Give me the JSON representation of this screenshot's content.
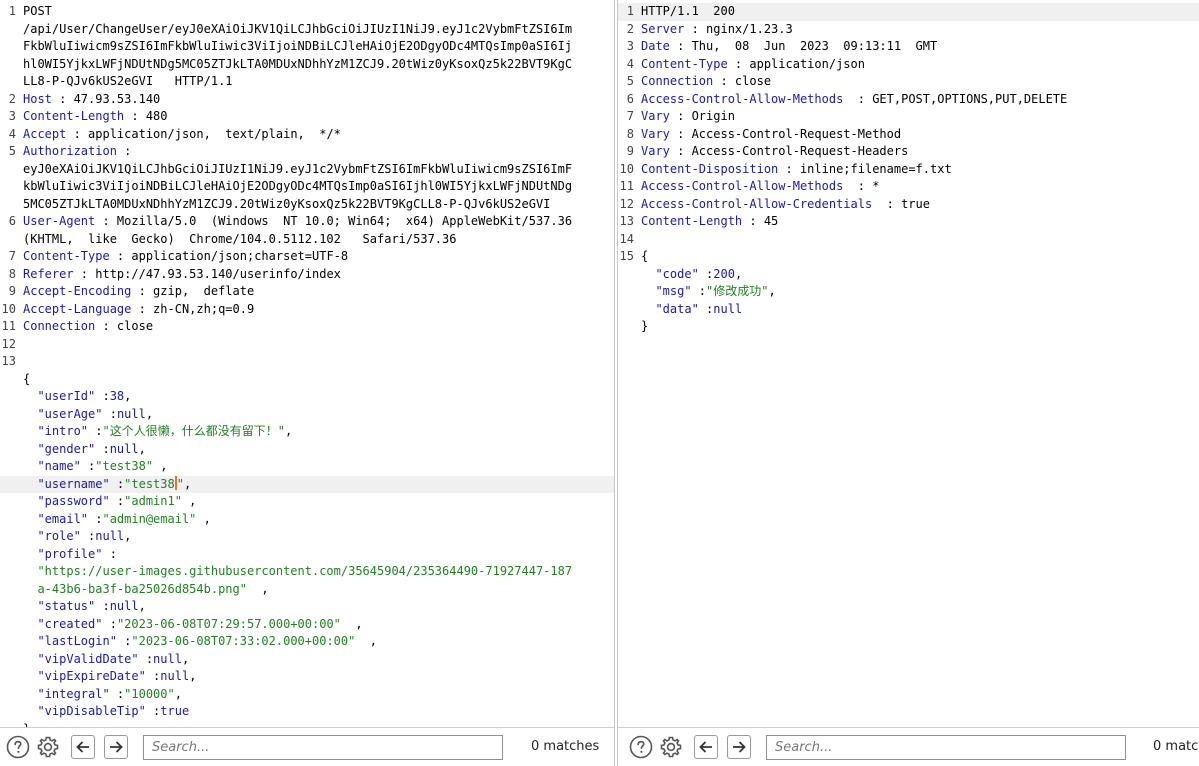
{
  "request": {
    "lines": [
      {
        "n": "1",
        "parts": [
          {
            "t": "POST",
            "c": ""
          }
        ]
      },
      {
        "n": "",
        "parts": [
          {
            "t": "/api/User/ChangeUser/eyJ0eXAiOiJKV1QiLCJhbGciOiJIUzI1NiJ9.eyJ1c2VybmFtZSI6Im",
            "c": ""
          }
        ]
      },
      {
        "n": "",
        "parts": [
          {
            "t": "FkbWluIiwicm9sZSI6ImFkbWluIiwic3ViIjoiNDBiLCJleHAiOjE2ODgyODc4MTQsImp0aSI6Ij",
            "c": ""
          }
        ]
      },
      {
        "n": "",
        "parts": [
          {
            "t": "hl0WI5YjkxLWFjNDUtNDg5MC05ZTJkLTA0MDUxNDhhYzM1ZCJ9.20tWiz0yKsoxQz5k22BVT9KgC",
            "c": ""
          }
        ]
      },
      {
        "n": "",
        "parts": [
          {
            "t": "LL8-P-QJv6kUS2eGVI   HTTP/1.1",
            "c": ""
          }
        ]
      },
      {
        "n": "2",
        "parts": [
          {
            "t": "Host",
            "c": "k"
          },
          {
            "t": " : 47.93.53.140",
            "c": ""
          }
        ]
      },
      {
        "n": "3",
        "parts": [
          {
            "t": "Content-Length",
            "c": "k"
          },
          {
            "t": " : 480",
            "c": ""
          }
        ]
      },
      {
        "n": "4",
        "parts": [
          {
            "t": "Accept",
            "c": "k"
          },
          {
            "t": " : application/json,  text/plain,  */*",
            "c": ""
          }
        ]
      },
      {
        "n": "5",
        "parts": [
          {
            "t": "Authorization",
            "c": "k"
          },
          {
            "t": " :",
            "c": ""
          }
        ]
      },
      {
        "n": "",
        "parts": [
          {
            "t": "eyJ0eXAiOiJKV1QiLCJhbGciOiJIUzI1NiJ9.eyJ1c2VybmFtZSI6ImFkbWluIiwicm9sZSI6ImF",
            "c": ""
          }
        ]
      },
      {
        "n": "",
        "parts": [
          {
            "t": "kbWluIiwic3ViIjoiNDBiLCJleHAiOjE2ODgyODc4MTQsImp0aSI6Ijhl0WI5YjkxLWFjNDUtNDg",
            "c": ""
          }
        ]
      },
      {
        "n": "",
        "parts": [
          {
            "t": "5MC05ZTJkLTA0MDUxNDhhYzM1ZCJ9.20tWiz0yKsoxQz5k22BVT9KgCLL8-P-QJv6kUS2eGVI",
            "c": ""
          }
        ]
      },
      {
        "n": "6",
        "parts": [
          {
            "t": "User-Agent",
            "c": "k"
          },
          {
            "t": " : Mozilla/5.0  (Windows  NT 10.0; Win64;  x64) AppleWebKit/537.36",
            "c": ""
          }
        ]
      },
      {
        "n": "",
        "parts": [
          {
            "t": "(KHTML,  like  Gecko)  Chrome/104.0.5112.102   Safari/537.36",
            "c": ""
          }
        ]
      },
      {
        "n": "7",
        "parts": [
          {
            "t": "Content-Type",
            "c": "k"
          },
          {
            "t": " : application/json;charset=UTF-8",
            "c": ""
          }
        ]
      },
      {
        "n": "8",
        "parts": [
          {
            "t": "Referer",
            "c": "k"
          },
          {
            "t": " : http://47.93.53.140/userinfo/index",
            "c": ""
          }
        ]
      },
      {
        "n": "9",
        "parts": [
          {
            "t": "Accept-Encoding",
            "c": "k"
          },
          {
            "t": " : gzip,  deflate",
            "c": ""
          }
        ]
      },
      {
        "n": "10",
        "parts": [
          {
            "t": "Accept-Language",
            "c": "k"
          },
          {
            "t": " : zh-CN,zh;q=0.9",
            "c": ""
          }
        ]
      },
      {
        "n": "11",
        "parts": [
          {
            "t": "Connection",
            "c": "k"
          },
          {
            "t": " : close",
            "c": ""
          }
        ]
      },
      {
        "n": "12",
        "parts": []
      },
      {
        "n": "13",
        "parts": []
      },
      {
        "n": "",
        "parts": [
          {
            "t": "{",
            "c": ""
          }
        ]
      },
      {
        "n": "",
        "parts": [
          {
            "t": "  \"userId\"",
            "c": "k"
          },
          {
            "t": " :",
            "c": ""
          },
          {
            "t": "38",
            "c": "n"
          },
          {
            "t": ",",
            "c": ""
          }
        ]
      },
      {
        "n": "",
        "parts": [
          {
            "t": "  \"userAge\"",
            "c": "k"
          },
          {
            "t": " :",
            "c": ""
          },
          {
            "t": "null",
            "c": "n"
          },
          {
            "t": ",",
            "c": ""
          }
        ]
      },
      {
        "n": "",
        "parts": [
          {
            "t": "  \"intro\"",
            "c": "k"
          },
          {
            "t": " :",
            "c": ""
          },
          {
            "t": "\"这个人很懒，什么都没有留下！\"",
            "c": "s"
          },
          {
            "t": ",",
            "c": ""
          }
        ]
      },
      {
        "n": "",
        "parts": [
          {
            "t": "  \"gender\"",
            "c": "k"
          },
          {
            "t": " :",
            "c": ""
          },
          {
            "t": "null",
            "c": "n"
          },
          {
            "t": ",",
            "c": ""
          }
        ]
      },
      {
        "n": "",
        "parts": [
          {
            "t": "  \"name\"",
            "c": "k"
          },
          {
            "t": " :",
            "c": ""
          },
          {
            "t": "\"test38\"",
            "c": "s"
          },
          {
            "t": " ,",
            "c": ""
          }
        ]
      },
      {
        "n": "",
        "hl": true,
        "caret": true,
        "parts": [
          {
            "t": "  \"username\"",
            "c": "k"
          },
          {
            "t": " :",
            "c": ""
          },
          {
            "t": "\"test38",
            "c": "s"
          },
          {
            "t": "\"",
            "c": "s",
            "caret": true
          },
          {
            "t": ",",
            "c": ""
          }
        ]
      },
      {
        "n": "",
        "parts": [
          {
            "t": "  \"password\"",
            "c": "k"
          },
          {
            "t": " :",
            "c": ""
          },
          {
            "t": "\"admin1\"",
            "c": "s"
          },
          {
            "t": " ,",
            "c": ""
          }
        ]
      },
      {
        "n": "",
        "parts": [
          {
            "t": "  \"email\"",
            "c": "k"
          },
          {
            "t": " :",
            "c": ""
          },
          {
            "t": "\"admin@email\"",
            "c": "s"
          },
          {
            "t": " ,",
            "c": ""
          }
        ]
      },
      {
        "n": "",
        "parts": [
          {
            "t": "  \"role\"",
            "c": "k"
          },
          {
            "t": " :",
            "c": ""
          },
          {
            "t": "null",
            "c": "n"
          },
          {
            "t": ",",
            "c": ""
          }
        ]
      },
      {
        "n": "",
        "parts": [
          {
            "t": "  \"profile\"",
            "c": "k"
          },
          {
            "t": " :",
            "c": ""
          }
        ]
      },
      {
        "n": "",
        "parts": [
          {
            "t": "  \"https://user-images.githubusercontent.com/35645904/235364490-71927447-187",
            "c": "s"
          }
        ]
      },
      {
        "n": "",
        "parts": [
          {
            "t": "  a-43b6-ba3f-ba25026d854b.png\"",
            "c": "s"
          },
          {
            "t": "  ,",
            "c": ""
          }
        ]
      },
      {
        "n": "",
        "parts": [
          {
            "t": "  \"status\"",
            "c": "k"
          },
          {
            "t": " :",
            "c": ""
          },
          {
            "t": "null",
            "c": "n"
          },
          {
            "t": ",",
            "c": ""
          }
        ]
      },
      {
        "n": "",
        "parts": [
          {
            "t": "  \"created\"",
            "c": "k"
          },
          {
            "t": " :",
            "c": ""
          },
          {
            "t": "\"2023-06-08T07:29:57.000+00:00\"",
            "c": "s"
          },
          {
            "t": "  ,",
            "c": ""
          }
        ]
      },
      {
        "n": "",
        "parts": [
          {
            "t": "  \"lastLogin\"",
            "c": "k"
          },
          {
            "t": " :",
            "c": ""
          },
          {
            "t": "\"2023-06-08T07:33:02.000+00:00\"",
            "c": "s"
          },
          {
            "t": "  ,",
            "c": ""
          }
        ]
      },
      {
        "n": "",
        "parts": [
          {
            "t": "  \"vipValidDate\"",
            "c": "k"
          },
          {
            "t": " :",
            "c": ""
          },
          {
            "t": "null",
            "c": "n"
          },
          {
            "t": ",",
            "c": ""
          }
        ]
      },
      {
        "n": "",
        "parts": [
          {
            "t": "  \"vipExpireDate\"",
            "c": "k"
          },
          {
            "t": " :",
            "c": ""
          },
          {
            "t": "null",
            "c": "n"
          },
          {
            "t": ",",
            "c": ""
          }
        ]
      },
      {
        "n": "",
        "parts": [
          {
            "t": "  \"integral\"",
            "c": "k"
          },
          {
            "t": " :",
            "c": ""
          },
          {
            "t": "\"10000\"",
            "c": "s"
          },
          {
            "t": ",",
            "c": ""
          }
        ]
      },
      {
        "n": "",
        "parts": [
          {
            "t": "  \"vipDisableTip\"",
            "c": "k"
          },
          {
            "t": " :",
            "c": ""
          },
          {
            "t": "true",
            "c": "n"
          }
        ]
      },
      {
        "n": "",
        "parts": [
          {
            "t": "}",
            "c": ""
          }
        ]
      }
    ],
    "search_placeholder": "Search...",
    "matches": "0 matches"
  },
  "response": {
    "lines": [
      {
        "n": "1",
        "hl": true,
        "parts": [
          {
            "t": "HTTP/1.1  200",
            "c": ""
          }
        ]
      },
      {
        "n": "2",
        "parts": [
          {
            "t": "Server",
            "c": "k"
          },
          {
            "t": " : nginx/1.23.3",
            "c": ""
          }
        ]
      },
      {
        "n": "3",
        "parts": [
          {
            "t": "Date",
            "c": "k"
          },
          {
            "t": " : Thu,  08  Jun  2023  09:13:11  GMT",
            "c": ""
          }
        ]
      },
      {
        "n": "4",
        "parts": [
          {
            "t": "Content-Type",
            "c": "k"
          },
          {
            "t": " : application/json",
            "c": ""
          }
        ]
      },
      {
        "n": "5",
        "parts": [
          {
            "t": "Connection",
            "c": "k"
          },
          {
            "t": " : close",
            "c": ""
          }
        ]
      },
      {
        "n": "6",
        "parts": [
          {
            "t": "Access-Control-Allow-Methods",
            "c": "k"
          },
          {
            "t": "  : GET,POST,OPTIONS,PUT,DELETE",
            "c": ""
          }
        ]
      },
      {
        "n": "7",
        "parts": [
          {
            "t": "Vary",
            "c": "k"
          },
          {
            "t": " : Origin",
            "c": ""
          }
        ]
      },
      {
        "n": "8",
        "parts": [
          {
            "t": "Vary",
            "c": "k"
          },
          {
            "t": " : Access-Control-Request-Method",
            "c": ""
          }
        ]
      },
      {
        "n": "9",
        "parts": [
          {
            "t": "Vary",
            "c": "k"
          },
          {
            "t": " : Access-Control-Request-Headers",
            "c": ""
          }
        ]
      },
      {
        "n": "10",
        "parts": [
          {
            "t": "Content-Disposition",
            "c": "k"
          },
          {
            "t": " : inline;filename=f.txt",
            "c": ""
          }
        ]
      },
      {
        "n": "11",
        "parts": [
          {
            "t": "Access-Control-Allow-Methods",
            "c": "k"
          },
          {
            "t": "  : *",
            "c": ""
          }
        ]
      },
      {
        "n": "12",
        "parts": [
          {
            "t": "Access-Control-Allow-Credentials",
            "c": "k"
          },
          {
            "t": "  : true",
            "c": ""
          }
        ]
      },
      {
        "n": "13",
        "parts": [
          {
            "t": "Content-Length",
            "c": "k"
          },
          {
            "t": " : 45",
            "c": ""
          }
        ]
      },
      {
        "n": "14",
        "parts": []
      },
      {
        "n": "15",
        "parts": [
          {
            "t": "{",
            "c": ""
          }
        ]
      },
      {
        "n": "",
        "parts": [
          {
            "t": "  \"code\"",
            "c": "k"
          },
          {
            "t": " :",
            "c": ""
          },
          {
            "t": "200",
            "c": "n"
          },
          {
            "t": ",",
            "c": ""
          }
        ]
      },
      {
        "n": "",
        "parts": [
          {
            "t": "  \"msg\"",
            "c": "k"
          },
          {
            "t": " :",
            "c": ""
          },
          {
            "t": "\"修改成功\"",
            "c": "s"
          },
          {
            "t": ",",
            "c": ""
          }
        ]
      },
      {
        "n": "",
        "parts": [
          {
            "t": "  \"data\"",
            "c": "k"
          },
          {
            "t": " :",
            "c": ""
          },
          {
            "t": "null",
            "c": "n"
          }
        ]
      },
      {
        "n": "",
        "parts": [
          {
            "t": "}",
            "c": ""
          }
        ]
      }
    ],
    "search_placeholder": "Search...",
    "matches": "0 matc"
  },
  "colors": {
    "key": "#1a1aa6",
    "string": "#228022",
    "caret": "#e8732b",
    "highlight": "#f0f0f0"
  },
  "icons": [
    "help-icon",
    "gear-icon",
    "arrow-left-icon",
    "arrow-right-icon"
  ]
}
